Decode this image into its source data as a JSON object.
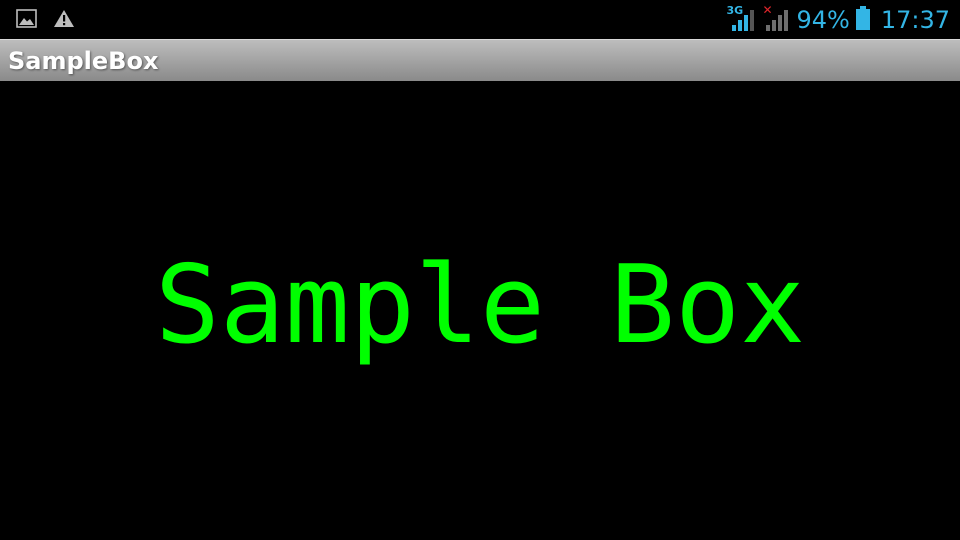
{
  "status_bar": {
    "network_type": "3G",
    "battery_percent": "94%",
    "time": "17:37",
    "icons": [
      "gallery-icon",
      "warning-icon",
      "signal-3g-icon",
      "signal-no-service-icon",
      "battery-icon"
    ],
    "accent_color": "#33b5e5"
  },
  "action_bar": {
    "title": "SampleBox"
  },
  "content": {
    "text": "Sample Box",
    "text_color": "#00ff00"
  }
}
